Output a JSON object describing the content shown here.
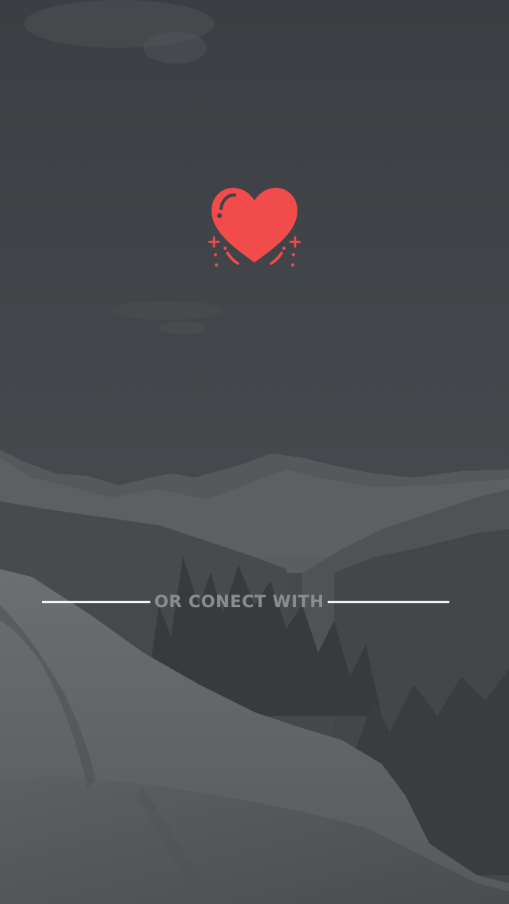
{
  "background": {
    "scene": "mountain-snow-photo-overlay",
    "overlay_color": "#3f4246"
  },
  "logo": {
    "icon": "heart-icon",
    "color": "#f24b4b"
  },
  "social_divider": {
    "label": "OR CONECT WITH"
  }
}
